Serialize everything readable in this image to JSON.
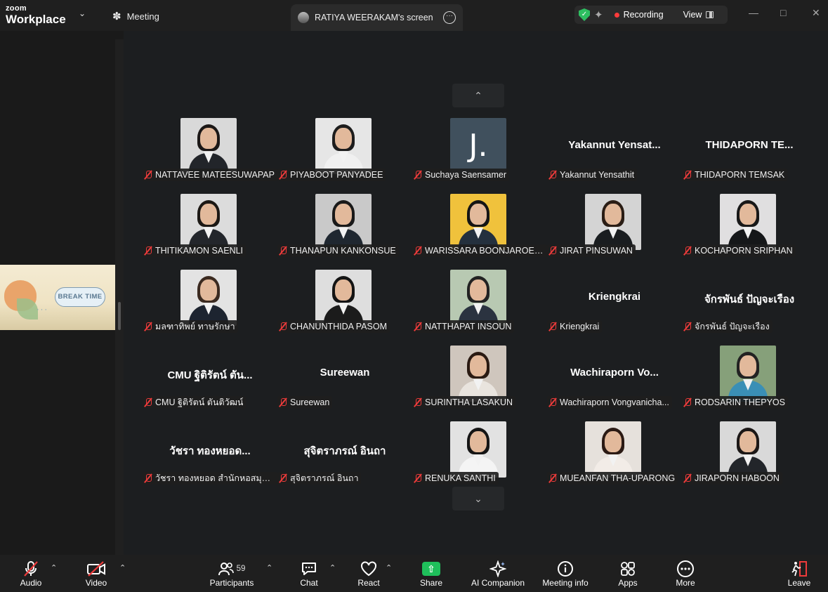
{
  "titlebar": {
    "logo_line1": "zoom",
    "logo_line2": "Workplace",
    "meeting_tab": "Meeting",
    "screen_tab": "RATIYA WEERAKAM's screen",
    "recording_label": "Recording",
    "view_label": "View"
  },
  "stage": {
    "thumbnail_text": "BREAK TIME"
  },
  "participants": [
    {
      "label": "NATTAVEE MATEESUWAPAP",
      "kind": "photo"
    },
    {
      "label": "PIYABOOT PANYADEE",
      "kind": "photo"
    },
    {
      "label": "Suchaya Saensamer",
      "kind": "letter",
      "letter": "J."
    },
    {
      "label": "Yakannut Yensathit",
      "kind": "name",
      "display": "Yakannut  Yensat..."
    },
    {
      "label": "THIDAPORN TEMSAK",
      "kind": "name",
      "display": "THIDAPORN  TE..."
    },
    {
      "label": "THITIKAMON SAENLI",
      "kind": "photo"
    },
    {
      "label": "THANAPUN KANKONSUE",
      "kind": "photo"
    },
    {
      "label": "WARISSARA BOONJAROEN...",
      "kind": "photo"
    },
    {
      "label": "JIRAT PINSUWAN",
      "kind": "photo"
    },
    {
      "label": "KOCHAPORN SRIPHAN",
      "kind": "photo"
    },
    {
      "label": "มลฑาทิพย์ ทาษรักษา",
      "kind": "photo"
    },
    {
      "label": "CHANUNTHIDA PASOM",
      "kind": "photo"
    },
    {
      "label": "NATTHAPAT INSOUN",
      "kind": "photo"
    },
    {
      "label": "Kriengkrai",
      "kind": "name",
      "display": "Kriengkrai"
    },
    {
      "label": "จักรพันธ์ ปัญจะเรือง",
      "kind": "name",
      "display": "จักรพันธ์ ปัญจะเรือง"
    },
    {
      "label": "CMU ฐิติรัตน์ ตันติวัฒน์",
      "kind": "name",
      "display": "CMU ฐิติรัตน์ ตัน..."
    },
    {
      "label": "Sureewan",
      "kind": "name",
      "display": "Sureewan"
    },
    {
      "label": "SURINTHA LASAKUN",
      "kind": "photo"
    },
    {
      "label": "Wachiraporn Vongvanicha...",
      "kind": "name",
      "display": "Wachiraporn  Vo..."
    },
    {
      "label": "RODSARIN THEPYOS",
      "kind": "photo"
    },
    {
      "label": "วัชรา  ทองหยอด สำนักหอสมุด ...",
      "kind": "name",
      "display": "วัชรา  ทองหยอด..."
    },
    {
      "label": "สุจิตราภรณ์ อินถา",
      "kind": "name",
      "display": "สุจิตราภรณ์ อินถา"
    },
    {
      "label": "RENUKA SANTHI",
      "kind": "photo"
    },
    {
      "label": "MUEANFAN THA-UPARONG",
      "kind": "photo"
    },
    {
      "label": "JIRAPORN HABOON",
      "kind": "photo"
    }
  ],
  "toolbar": {
    "audio": "Audio",
    "video": "Video",
    "participants": "Participants",
    "participants_count": "59",
    "chat": "Chat",
    "react": "React",
    "share": "Share",
    "ai_companion": "AI Companion",
    "meeting_info": "Meeting info",
    "apps": "Apps",
    "more": "More",
    "leave": "Leave"
  },
  "colors": {
    "recording_dot": "#ff3b3b",
    "share_green": "#1fbf5b",
    "muted_red": "#ee3b3b",
    "shield_green": "#2dbe60"
  }
}
